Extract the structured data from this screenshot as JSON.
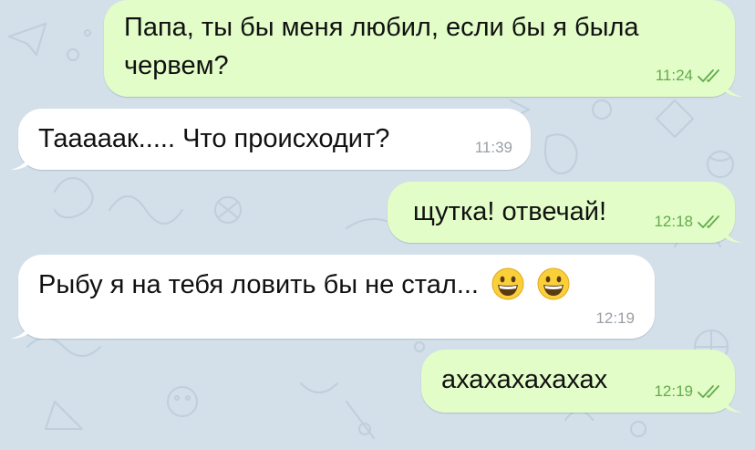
{
  "chat": {
    "colors": {
      "background": "#d3dfe9",
      "outgoing_bubble": "#e2fdc8",
      "incoming_bubble": "#ffffff",
      "outgoing_time": "#62ab4c",
      "incoming_time": "#9aa0a6"
    },
    "messages": [
      {
        "direction": "outgoing",
        "text_line1": "Папа, ты бы меня любил, если бы я была",
        "text_line2": "червем?",
        "time": "11:24",
        "status_icon": "double-check-icon"
      },
      {
        "direction": "incoming",
        "text": "Тааааак..... Что происходит?",
        "time": "11:39"
      },
      {
        "direction": "outgoing",
        "text": "щутка! отвечай!",
        "time": "12:18",
        "status_icon": "double-check-icon"
      },
      {
        "direction": "incoming",
        "text": "Рыбу я на тебя ловить бы не стал...",
        "emoji": [
          "grinning-face-emoji",
          "grinning-face-emoji"
        ],
        "time": "12:19"
      },
      {
        "direction": "outgoing",
        "text": "ахахахахахах",
        "time": "12:19",
        "status_icon": "double-check-icon"
      }
    ]
  }
}
